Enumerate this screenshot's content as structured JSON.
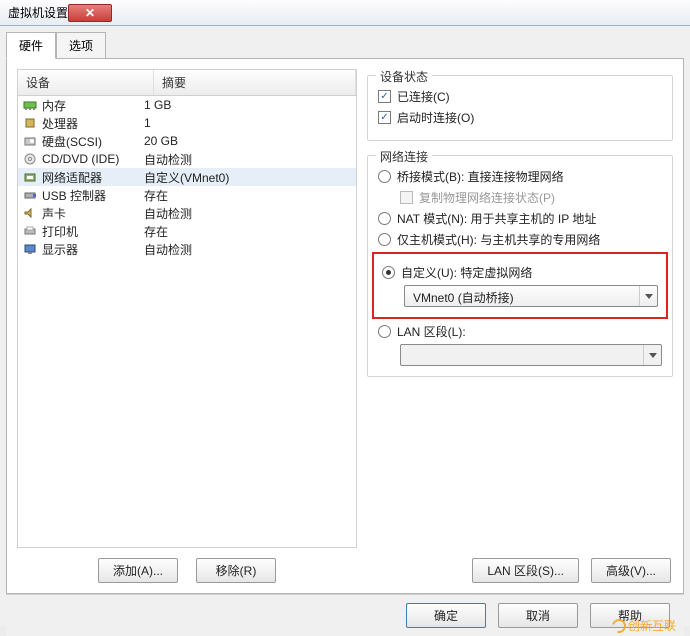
{
  "window": {
    "title": "虚拟机设置"
  },
  "tabs": {
    "hardware": "硬件",
    "options": "选项"
  },
  "table": {
    "headers": {
      "device": "设备",
      "summary": "摘要"
    },
    "rows": [
      {
        "name": "内存",
        "summary": "1 GB",
        "icon": "memory"
      },
      {
        "name": "处理器",
        "summary": "1",
        "icon": "cpu"
      },
      {
        "name": "硬盘(SCSI)",
        "summary": "20 GB",
        "icon": "disk"
      },
      {
        "name": "CD/DVD (IDE)",
        "summary": "自动检测",
        "icon": "cd"
      },
      {
        "name": "网络适配器",
        "summary": "自定义(VMnet0)",
        "icon": "nic",
        "selected": true
      },
      {
        "name": "USB 控制器",
        "summary": "存在",
        "icon": "usb"
      },
      {
        "name": "声卡",
        "summary": "自动检测",
        "icon": "sound"
      },
      {
        "name": "打印机",
        "summary": "存在",
        "icon": "printer"
      },
      {
        "name": "显示器",
        "summary": "自动检测",
        "icon": "display"
      }
    ]
  },
  "buttons": {
    "add": "添加(A)...",
    "remove": "移除(R)",
    "lan_segments": "LAN 区段(S)...",
    "advanced": "高级(V)...",
    "ok": "确定",
    "cancel": "取消",
    "help": "帮助"
  },
  "status_group": {
    "title": "设备状态",
    "connected": "已连接(C)",
    "connect_at_power_on": "启动时连接(O)"
  },
  "net_group": {
    "title": "网络连接",
    "bridged": "桥接模式(B): 直接连接物理网络",
    "replicate": "复制物理网络连接状态(P)",
    "nat": "NAT 模式(N): 用于共享主机的 IP 地址",
    "hostonly": "仅主机模式(H): 与主机共享的专用网络",
    "custom": "自定义(U): 特定虚拟网络",
    "custom_value": "VMnet0 (自动桥接)",
    "lan": "LAN 区段(L):",
    "lan_value": ""
  },
  "watermark": "创新互联"
}
